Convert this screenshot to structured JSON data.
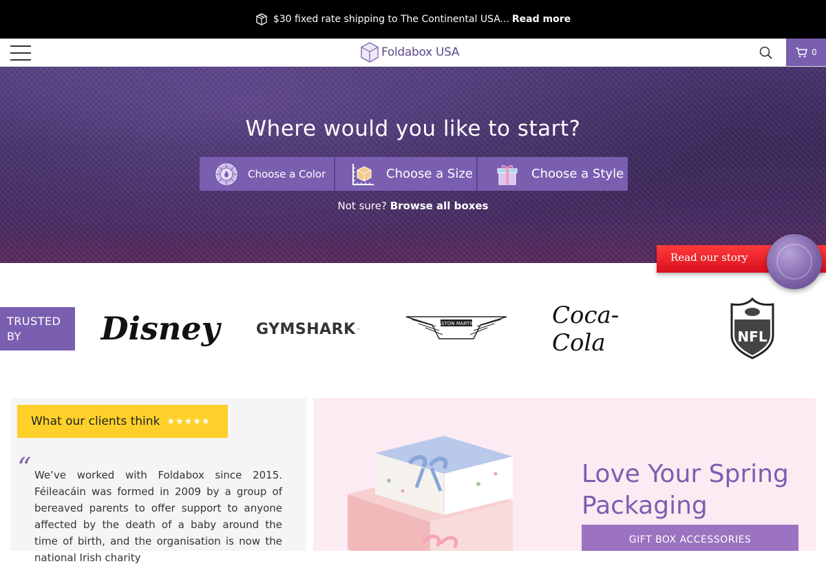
{
  "announcement": {
    "icon": "box-icon",
    "text": "$30 fixed rate shipping to The Continental USA...",
    "link": "Read more"
  },
  "header": {
    "menu_icon": "hamburger-menu-icon",
    "logo_text": "Foldabox USA",
    "search_icon": "search-icon",
    "cart_icon": "shopping-cart-icon",
    "cart_count": "0"
  },
  "hero": {
    "title": "Where would you like to start?",
    "choices": [
      {
        "label": "Choose a Color",
        "icon": "color-wheel-icon"
      },
      {
        "label": "Choose a Size",
        "icon": "ruler-box-icon"
      },
      {
        "label": "Choose a Style",
        "icon": "gift-box-icon"
      }
    ],
    "sub_prefix": "Not sure?",
    "sub_link": "Browse all boxes"
  },
  "story": {
    "label": "Read our story"
  },
  "trusted": {
    "label": "TRUSTED BY",
    "brands": [
      "Disney",
      "GYMSHARK",
      "ASTON MARTIN",
      "Coca-Cola",
      "NFL"
    ]
  },
  "testimonial": {
    "badge": "What our clients think",
    "stars": "★★★★★",
    "quote_mark": "“",
    "text": "We’ve worked with Foldabox since 2015. Féileacáin was formed in 2009 by a group of bereaved parents to offer support to anyone affected by the death of a baby around the time of birth, and the organisation is now the national Irish charity"
  },
  "promo": {
    "title": "Love Your Spring Packaging",
    "button": "GIFT BOX ACCESSORIES"
  },
  "colors": {
    "brand_purple": "#7a5fb0",
    "badge_yellow": "#ffd02a",
    "promo_bg": "#fcebf3",
    "ribbon_red": "#e81f2b"
  }
}
